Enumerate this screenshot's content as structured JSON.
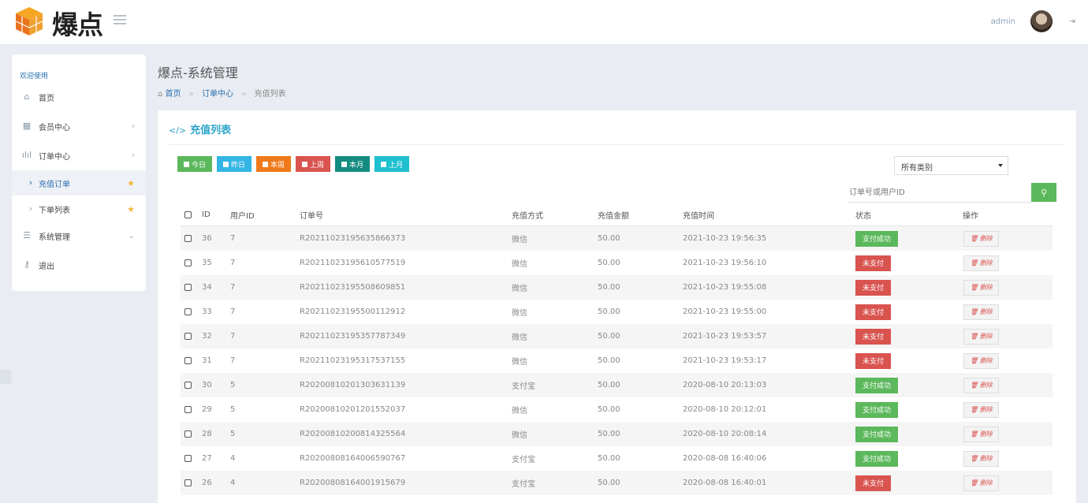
{
  "header": {
    "logo_text": "爆点",
    "admin_name": "admin"
  },
  "sidebar": {
    "title": "欢迎使用",
    "items": [
      {
        "label": "首页"
      },
      {
        "label": "会员中心"
      },
      {
        "label": "订单中心"
      },
      {
        "label": "充值订单"
      },
      {
        "label": "下单列表"
      },
      {
        "label": "系统管理"
      },
      {
        "label": "退出"
      }
    ]
  },
  "page": {
    "title": "爆点-系统管理",
    "breadcrumb": {
      "home": "首页",
      "section": "订单中心",
      "current": "充值列表"
    }
  },
  "panel": {
    "title": "充值列表",
    "quick_buttons": [
      {
        "label": "今日",
        "color": "#5cb85c"
      },
      {
        "label": "昨日",
        "color": "#33b5e5"
      },
      {
        "label": "本周",
        "color": "#f07a1a"
      },
      {
        "label": "上周",
        "color": "#d9534f"
      },
      {
        "label": "本月",
        "color": "#138b7f"
      },
      {
        "label": "上月",
        "color": "#1fc0d0"
      }
    ],
    "category_select": "所有类别",
    "search_placeholder": "订单号或用户ID"
  },
  "table": {
    "columns": [
      "ID",
      "用户ID",
      "订单号",
      "充值方式",
      "充值金额",
      "充值时间",
      "状态",
      "操作"
    ],
    "delete_label": "删除",
    "rows": [
      {
        "id": "36",
        "uid": "7",
        "no": "R20211023195635866373",
        "way": "微信",
        "amount": "50.00",
        "time": "2021-10-23 19:56:35",
        "status": "支付成功",
        "paid": true
      },
      {
        "id": "35",
        "uid": "7",
        "no": "R20211023195610577519",
        "way": "微信",
        "amount": "50.00",
        "time": "2021-10-23 19:56:10",
        "status": "未支付",
        "paid": false
      },
      {
        "id": "34",
        "uid": "7",
        "no": "R20211023195508609851",
        "way": "微信",
        "amount": "50.00",
        "time": "2021-10-23 19:55:08",
        "status": "未支付",
        "paid": false
      },
      {
        "id": "33",
        "uid": "7",
        "no": "R20211023195500112912",
        "way": "微信",
        "amount": "50.00",
        "time": "2021-10-23 19:55:00",
        "status": "未支付",
        "paid": false
      },
      {
        "id": "32",
        "uid": "7",
        "no": "R20211023195357787349",
        "way": "微信",
        "amount": "50.00",
        "time": "2021-10-23 19:53:57",
        "status": "未支付",
        "paid": false
      },
      {
        "id": "31",
        "uid": "7",
        "no": "R20211023195317537155",
        "way": "微信",
        "amount": "50.00",
        "time": "2021-10-23 19:53:17",
        "status": "未支付",
        "paid": false
      },
      {
        "id": "30",
        "uid": "5",
        "no": "R20200810201303631139",
        "way": "支付宝",
        "amount": "50.00",
        "time": "2020-08-10 20:13:03",
        "status": "支付成功",
        "paid": true
      },
      {
        "id": "29",
        "uid": "5",
        "no": "R20200810201201552037",
        "way": "微信",
        "amount": "50.00",
        "time": "2020-08-10 20:12:01",
        "status": "支付成功",
        "paid": true
      },
      {
        "id": "28",
        "uid": "5",
        "no": "R20200810200814325564",
        "way": "微信",
        "amount": "50.00",
        "time": "2020-08-10 20:08:14",
        "status": "支付成功",
        "paid": true
      },
      {
        "id": "27",
        "uid": "4",
        "no": "R20200808164006590767",
        "way": "支付宝",
        "amount": "50.00",
        "time": "2020-08-08 16:40:06",
        "status": "支付成功",
        "paid": true
      },
      {
        "id": "26",
        "uid": "4",
        "no": "R20200808164001915679",
        "way": "支付宝",
        "amount": "50.00",
        "time": "2020-08-08 16:40:01",
        "status": "未支付",
        "paid": false
      }
    ]
  }
}
